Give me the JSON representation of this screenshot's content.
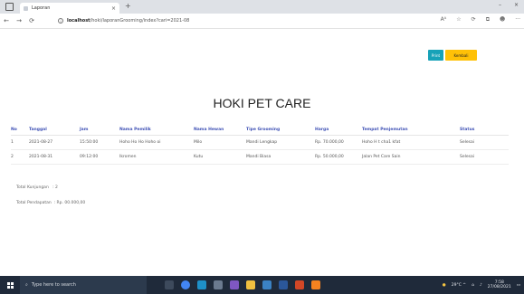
{
  "browser": {
    "tab_title": "Laporan",
    "tab_close": "×",
    "new_tab": "+",
    "window_controls": [
      "–",
      "×"
    ],
    "url_host": "localhost",
    "url_path": "/hoki/laporanGrooming/index?cari=2021-08",
    "toolbar_icons": [
      "Aᴬ",
      "☆",
      "⟳",
      "⧉",
      "☻",
      "···"
    ]
  },
  "actions": {
    "print_label": "Print",
    "back_label": "Kembali"
  },
  "page": {
    "title": "HOKI PET CARE"
  },
  "table": {
    "headers": [
      "No",
      "Tanggal",
      "Jam",
      "Nama Pemilik",
      "Nama Hewan",
      "Tipe Grooming",
      "Harga",
      "Tempat Penjemutan",
      "Status"
    ],
    "rows": [
      [
        "1",
        "2021-08-27",
        "15:50:00",
        "Hoho Ho Ho Hoho oi",
        "Milo",
        "Mandi Lengkap",
        "Rp. 70.000,00",
        "Hoho H t cha1 kfat",
        "Selesai"
      ],
      [
        "2",
        "2021-08-31",
        "09:12:00",
        "Ikromen",
        "Kutu",
        "Mandi Biasa",
        "Rp. 50.000,00",
        "Jalan Pet Care Sain",
        "Selesai"
      ]
    ]
  },
  "summary": {
    "kunjungan_label": "Total Kunjungan",
    "kunjungan_value": ": 2",
    "pendapatan_label": "Total Pendapatan",
    "pendapatan_value": ": Rp. 00.000,00"
  },
  "taskbar": {
    "search_placeholder": "Type here to search",
    "tray_text": "29°C  ^",
    "time": "7:58",
    "date": "27/08/2021"
  }
}
